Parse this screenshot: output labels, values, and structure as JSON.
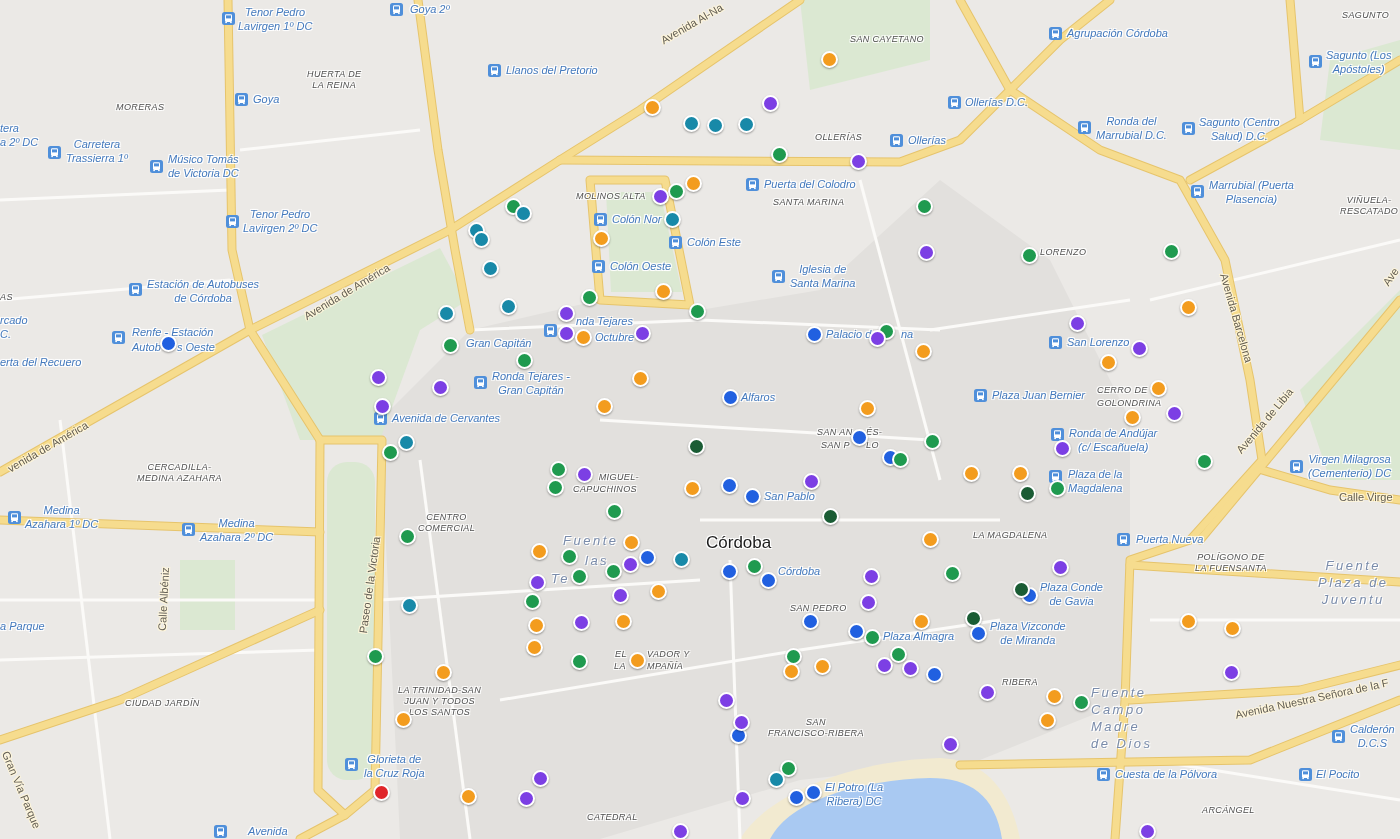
{
  "map": {
    "labels": [
      {
        "kind": "stop",
        "text": "Tenor Pedro Lavirgen 1º DC"
      },
      {
        "kind": "stop",
        "text": "Goya 2º"
      },
      {
        "kind": "street",
        "text": "Avenida Al-Na"
      },
      {
        "kind": "district",
        "text": "SAN CAYETANO"
      },
      {
        "kind": "stop",
        "text": "Agrupación Córdoba"
      },
      {
        "kind": "district",
        "text": "SAGUNTO"
      },
      {
        "kind": "district",
        "text": "HUERTA DE LA REINA"
      },
      {
        "kind": "stop",
        "text": "Llanos del Pretorio"
      },
      {
        "kind": "stop",
        "text": "Sagunto (Los Apóstoles)"
      },
      {
        "kind": "district",
        "text": "MORERAS"
      },
      {
        "kind": "stop",
        "text": "Goya"
      },
      {
        "kind": "stop",
        "text": "Ollerías D.C."
      },
      {
        "kind": "stop_text",
        "text": "tera a 2º DC"
      },
      {
        "kind": "stop",
        "text": "Carretera Trassierra 1º"
      },
      {
        "kind": "stop",
        "text": "Músico Tomás de Victoria DC"
      },
      {
        "kind": "district",
        "text": "OLLERÍAS"
      },
      {
        "kind": "stop",
        "text": "Ollerías"
      },
      {
        "kind": "stop",
        "text": "Ronda del Marrubial D.C."
      },
      {
        "kind": "stop",
        "text": "Sagunto (Centro Salud) D.C."
      },
      {
        "kind": "district",
        "text": "MOLINOS ALTA"
      },
      {
        "kind": "stop",
        "text": "Puerta del Colodro"
      },
      {
        "kind": "district",
        "text": "SANTA MARINA"
      },
      {
        "kind": "stop",
        "text": "Marrubial (Puerta Plasencia)"
      },
      {
        "kind": "stop",
        "text": "Tenor Pedro Lavirgen 2º DC"
      },
      {
        "kind": "stop",
        "text": "Colón Nor"
      },
      {
        "kind": "district",
        "text": "VIÑUELA-RESCATADO"
      },
      {
        "kind": "stop",
        "text": "Colón Este"
      },
      {
        "kind": "district",
        "text": "LORENZO"
      },
      {
        "kind": "stop",
        "text": "Colón Oeste"
      },
      {
        "kind": "street",
        "text": "Ave"
      },
      {
        "kind": "district",
        "text": "AS"
      },
      {
        "kind": "stop",
        "text": "Estación de Autobuses de Córdoba"
      },
      {
        "kind": "stop",
        "text": "Iglesia de Santa Marina"
      },
      {
        "kind": "street",
        "text": "Avenida de América"
      },
      {
        "kind": "street",
        "text": "Avenida Barcelona"
      },
      {
        "kind": "stop_text",
        "text": "rcado C."
      },
      {
        "kind": "stop",
        "text": "Renfe - Estación"
      },
      {
        "kind": "stop_text",
        "text": "Autob"
      },
      {
        "kind": "stop_text",
        "text": "s Oeste"
      },
      {
        "kind": "stop_text",
        "text": "Gran Capitán"
      },
      {
        "kind": "stop",
        "text": "nda Tejares"
      },
      {
        "kind": "stop_text",
        "text": "Octubre"
      },
      {
        "kind": "stop_text",
        "text": "Palacio d"
      },
      {
        "kind": "stop_text",
        "text": "na"
      },
      {
        "kind": "stop",
        "text": "San Lorenzo"
      },
      {
        "kind": "stop_text",
        "text": "erta del Recuero"
      },
      {
        "kind": "stop",
        "text": "Ronda Tejares - Gran Capitán"
      },
      {
        "kind": "stop_text",
        "text": "Alfaros"
      },
      {
        "kind": "stop",
        "text": "Plaza Juan Bernier"
      },
      {
        "kind": "district",
        "text": "CERRO DE"
      },
      {
        "kind": "district",
        "text": "GOLONDRINA"
      },
      {
        "kind": "street",
        "text": "venida de América"
      },
      {
        "kind": "stop",
        "text": "Avenida de Cervantes"
      },
      {
        "kind": "district",
        "text": "SAN AN"
      },
      {
        "kind": "district",
        "text": "ÉS-"
      },
      {
        "kind": "district",
        "text": "SAN P"
      },
      {
        "kind": "district",
        "text": "LO"
      },
      {
        "kind": "stop",
        "text": "Ronda de Andújar (c/ Escañuela)"
      },
      {
        "kind": "street",
        "text": "Avenida de Libia"
      },
      {
        "kind": "district",
        "text": "CERCADILLA-MEDINA AZAHARA"
      },
      {
        "kind": "district",
        "text": "MIGUEL-"
      },
      {
        "kind": "district",
        "text": "CAPUCHINOS"
      },
      {
        "kind": "stop_text",
        "text": "San Pablo"
      },
      {
        "kind": "stop",
        "text": "Plaza de la Magdalena"
      },
      {
        "kind": "stop",
        "text": "Virgen Milagrosa (Cementerio) DC"
      },
      {
        "kind": "street",
        "text": "Calle Virge"
      },
      {
        "kind": "stop",
        "text": "Medina Azahara 1º DC"
      },
      {
        "kind": "stop",
        "text": "Medina Azahara 2º DC"
      },
      {
        "kind": "district",
        "text": "CENTRO COMERCIAL"
      },
      {
        "kind": "area",
        "text": "Fuente"
      },
      {
        "kind": "city",
        "text": "Córdoba"
      },
      {
        "kind": "district",
        "text": "LA MAGDALENA"
      },
      {
        "kind": "stop",
        "text": "Puerta Nueva"
      },
      {
        "kind": "area",
        "text": "las"
      },
      {
        "kind": "area",
        "text": "Te"
      },
      {
        "kind": "stop_text",
        "text": "Córdoba"
      },
      {
        "kind": "district",
        "text": "POLÍGONO DE LA FUENSANTA"
      },
      {
        "kind": "street",
        "text": "Paseo de la Victoria"
      },
      {
        "kind": "street",
        "text": "Calle Albéniz"
      },
      {
        "kind": "district",
        "text": "SAN PEDRO"
      },
      {
        "kind": "stop_text",
        "text": "Plaza Conde de Gavia"
      },
      {
        "kind": "area",
        "text": "Fuente Plaza de Juventu"
      },
      {
        "kind": "stop_text",
        "text": "a Parque"
      },
      {
        "kind": "stop_text",
        "text": "Plaza Almagra"
      },
      {
        "kind": "stop_text",
        "text": "Plaza Vizconde de Miranda"
      },
      {
        "kind": "district",
        "text": "EL"
      },
      {
        "kind": "district",
        "text": "VADOR Y"
      },
      {
        "kind": "district",
        "text": "LA"
      },
      {
        "kind": "district",
        "text": "MPAÑÍA"
      },
      {
        "kind": "district",
        "text": "CIUDAD JARDÍN"
      },
      {
        "kind": "district",
        "text": "LA TRINIDAD-SAN JUAN Y TODOS LOS SANTOS"
      },
      {
        "kind": "district",
        "text": "RIBERA"
      },
      {
        "kind": "district",
        "text": "SAN FRANCISCO-RIBERA"
      },
      {
        "kind": "area",
        "text": "Fuente Campo Madre de Dios"
      },
      {
        "kind": "street",
        "text": "Avenida Nuestra Señora de la F"
      },
      {
        "kind": "stop",
        "text": "Calderón D.C.S"
      },
      {
        "kind": "stop",
        "text": "Glorieta de la Cruz Roja"
      },
      {
        "kind": "stop",
        "text": "Cuesta de la Pólvora"
      },
      {
        "kind": "stop",
        "text": "El Pocito"
      },
      {
        "kind": "stop_text",
        "text": "El Potro (La Ribera) DC"
      },
      {
        "kind": "street",
        "text": "Gran Vía Parque"
      },
      {
        "kind": "district",
        "text": "CATEDRAL"
      },
      {
        "kind": "district",
        "text": "ARCÁNGEL"
      },
      {
        "kind": "stop",
        "text": "Avenida"
      }
    ],
    "markers": [
      {
        "color": "#f39c1e"
      },
      {
        "color": "#f39c1e"
      },
      {
        "color": "#7c3fe4"
      },
      {
        "color": "#1889a8"
      },
      {
        "color": "#1889a8"
      },
      {
        "color": "#1889a8"
      },
      {
        "color": "#1f9a4f"
      },
      {
        "color": "#7c3fe4"
      },
      {
        "color": "#f39c1e"
      },
      {
        "color": "#1f9a4f"
      },
      {
        "color": "#7c3fe4"
      },
      {
        "color": "#1f9a4f"
      },
      {
        "color": "#1889a8"
      },
      {
        "color": "#1f9a4f"
      },
      {
        "color": "#1889a8"
      },
      {
        "color": "#1889a8"
      },
      {
        "color": "#1889a8"
      },
      {
        "color": "#f39c1e"
      },
      {
        "color": "#7c3fe4"
      },
      {
        "color": "#1f9a4f"
      },
      {
        "color": "#1f9a4f"
      },
      {
        "color": "#1889a8"
      },
      {
        "color": "#f39c1e"
      },
      {
        "color": "#1f9a4f"
      },
      {
        "color": "#1889a8"
      },
      {
        "color": "#1f9a4f"
      },
      {
        "color": "#f39c1e"
      },
      {
        "color": "#1889a8"
      },
      {
        "color": "#7c3fe4"
      },
      {
        "color": "#7c3fe4"
      },
      {
        "color": "#7c3fe4"
      },
      {
        "color": "#f39c1e"
      },
      {
        "color": "#7c3fe4"
      },
      {
        "color": "#2160e0"
      },
      {
        "color": "#1f9a4f"
      },
      {
        "color": "#7c3fe4"
      },
      {
        "color": "#2160e0"
      },
      {
        "color": "#1f9a4f"
      },
      {
        "color": "#7c3fe4"
      },
      {
        "color": "#f39c1e"
      },
      {
        "color": "#f39c1e"
      },
      {
        "color": "#1f9a4f"
      },
      {
        "color": "#7c3fe4"
      },
      {
        "color": "#f39c1e"
      },
      {
        "color": "#7c3fe4"
      },
      {
        "color": "#f39c1e"
      },
      {
        "color": "#2160e0"
      },
      {
        "color": "#7c3fe4"
      },
      {
        "color": "#f39c1e"
      },
      {
        "color": "#f39c1e"
      },
      {
        "color": "#7c3fe4"
      },
      {
        "color": "#f39c1e"
      },
      {
        "color": "#1889a8"
      },
      {
        "color": "#2160e0"
      },
      {
        "color": "#1a5c34"
      },
      {
        "color": "#1f9a4f"
      },
      {
        "color": "#7c3fe4"
      },
      {
        "color": "#1f9a4f"
      },
      {
        "color": "#2160e0"
      },
      {
        "color": "#1f9a4f"
      },
      {
        "color": "#1f9a4f"
      },
      {
        "color": "#1f9a4f"
      },
      {
        "color": "#7c3fe4"
      },
      {
        "color": "#f39c1e"
      },
      {
        "color": "#f39c1e"
      },
      {
        "color": "#7c3fe4"
      },
      {
        "color": "#2160e0"
      },
      {
        "color": "#1f9a4f"
      },
      {
        "color": "#f39c1e"
      },
      {
        "color": "#1f9a4f"
      },
      {
        "color": "#1a5c34"
      },
      {
        "color": "#2160e0"
      },
      {
        "color": "#1f9a4f"
      },
      {
        "color": "#1a5c34"
      },
      {
        "color": "#1f9a4f"
      },
      {
        "color": "#f39c1e"
      },
      {
        "color": "#f39c1e"
      },
      {
        "color": "#f39c1e"
      },
      {
        "color": "#1f9a4f"
      },
      {
        "color": "#1889a8"
      },
      {
        "color": "#2160e0"
      },
      {
        "color": "#7c3fe4"
      },
      {
        "color": "#1f9a4f"
      },
      {
        "color": "#7c3fe4"
      },
      {
        "color": "#2160e0"
      },
      {
        "color": "#1f9a4f"
      },
      {
        "color": "#1f9a4f"
      },
      {
        "color": "#7c3fe4"
      },
      {
        "color": "#1f9a4f"
      },
      {
        "color": "#2160e0"
      },
      {
        "color": "#7c3fe4"
      },
      {
        "color": "#2160e0"
      },
      {
        "color": "#1a5c34"
      },
      {
        "color": "#f39c1e"
      },
      {
        "color": "#7c3fe4"
      },
      {
        "color": "#1f9a4f"
      },
      {
        "color": "#7c3fe4"
      },
      {
        "color": "#1889a8"
      },
      {
        "color": "#1a5c34"
      },
      {
        "color": "#2160e0"
      },
      {
        "color": "#f39c1e"
      },
      {
        "color": "#7c3fe4"
      },
      {
        "color": "#f39c1e"
      },
      {
        "color": "#f39c1e"
      },
      {
        "color": "#f39c1e"
      },
      {
        "color": "#f39c1e"
      },
      {
        "color": "#1f9a4f"
      },
      {
        "color": "#2160e0"
      },
      {
        "color": "#2160e0"
      },
      {
        "color": "#f39c1e"
      },
      {
        "color": "#1f9a4f"
      },
      {
        "color": "#1f9a4f"
      },
      {
        "color": "#1f9a4f"
      },
      {
        "color": "#1f9a4f"
      },
      {
        "color": "#f39c1e"
      },
      {
        "color": "#7c3fe4"
      },
      {
        "color": "#7c3fe4"
      },
      {
        "color": "#f39c1e"
      },
      {
        "color": "#f39c1e"
      },
      {
        "color": "#f39c1e"
      },
      {
        "color": "#7c3fe4"
      },
      {
        "color": "#2160e0"
      },
      {
        "color": "#7c3fe4"
      },
      {
        "color": "#f39c1e"
      },
      {
        "color": "#7c3fe4"
      },
      {
        "color": "#1f9a4f"
      },
      {
        "color": "#f39c1e"
      },
      {
        "color": "#f39c1e"
      },
      {
        "color": "#2160e0"
      },
      {
        "color": "#7c3fe4"
      },
      {
        "color": "#7c3fe4"
      },
      {
        "color": "#1f9a4f"
      },
      {
        "color": "#7c3fe4"
      },
      {
        "color": "#1889a8"
      },
      {
        "color": "#e0262b"
      },
      {
        "color": "#2160e0"
      },
      {
        "color": "#f39c1e"
      },
      {
        "color": "#2160e0"
      },
      {
        "color": "#7c3fe4"
      },
      {
        "color": "#7c3fe4"
      },
      {
        "color": "#7c3fe4"
      },
      {
        "color": "#7c3fe4"
      }
    ]
  }
}
